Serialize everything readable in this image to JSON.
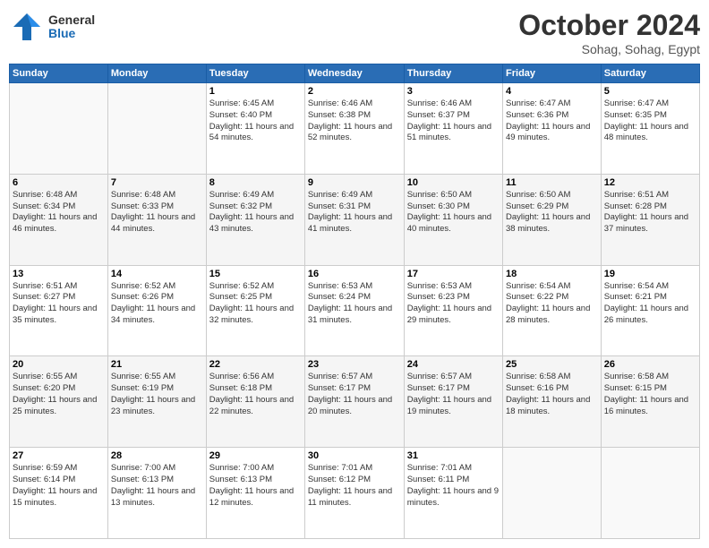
{
  "header": {
    "logo_general": "General",
    "logo_blue": "Blue",
    "month": "October 2024",
    "location": "Sohag, Sohag, Egypt"
  },
  "weekdays": [
    "Sunday",
    "Monday",
    "Tuesday",
    "Wednesday",
    "Thursday",
    "Friday",
    "Saturday"
  ],
  "weeks": [
    [
      {
        "day": "",
        "info": ""
      },
      {
        "day": "",
        "info": ""
      },
      {
        "day": "1",
        "info": "Sunrise: 6:45 AM\nSunset: 6:40 PM\nDaylight: 11 hours and 54 minutes."
      },
      {
        "day": "2",
        "info": "Sunrise: 6:46 AM\nSunset: 6:38 PM\nDaylight: 11 hours and 52 minutes."
      },
      {
        "day": "3",
        "info": "Sunrise: 6:46 AM\nSunset: 6:37 PM\nDaylight: 11 hours and 51 minutes."
      },
      {
        "day": "4",
        "info": "Sunrise: 6:47 AM\nSunset: 6:36 PM\nDaylight: 11 hours and 49 minutes."
      },
      {
        "day": "5",
        "info": "Sunrise: 6:47 AM\nSunset: 6:35 PM\nDaylight: 11 hours and 48 minutes."
      }
    ],
    [
      {
        "day": "6",
        "info": "Sunrise: 6:48 AM\nSunset: 6:34 PM\nDaylight: 11 hours and 46 minutes."
      },
      {
        "day": "7",
        "info": "Sunrise: 6:48 AM\nSunset: 6:33 PM\nDaylight: 11 hours and 44 minutes."
      },
      {
        "day": "8",
        "info": "Sunrise: 6:49 AM\nSunset: 6:32 PM\nDaylight: 11 hours and 43 minutes."
      },
      {
        "day": "9",
        "info": "Sunrise: 6:49 AM\nSunset: 6:31 PM\nDaylight: 11 hours and 41 minutes."
      },
      {
        "day": "10",
        "info": "Sunrise: 6:50 AM\nSunset: 6:30 PM\nDaylight: 11 hours and 40 minutes."
      },
      {
        "day": "11",
        "info": "Sunrise: 6:50 AM\nSunset: 6:29 PM\nDaylight: 11 hours and 38 minutes."
      },
      {
        "day": "12",
        "info": "Sunrise: 6:51 AM\nSunset: 6:28 PM\nDaylight: 11 hours and 37 minutes."
      }
    ],
    [
      {
        "day": "13",
        "info": "Sunrise: 6:51 AM\nSunset: 6:27 PM\nDaylight: 11 hours and 35 minutes."
      },
      {
        "day": "14",
        "info": "Sunrise: 6:52 AM\nSunset: 6:26 PM\nDaylight: 11 hours and 34 minutes."
      },
      {
        "day": "15",
        "info": "Sunrise: 6:52 AM\nSunset: 6:25 PM\nDaylight: 11 hours and 32 minutes."
      },
      {
        "day": "16",
        "info": "Sunrise: 6:53 AM\nSunset: 6:24 PM\nDaylight: 11 hours and 31 minutes."
      },
      {
        "day": "17",
        "info": "Sunrise: 6:53 AM\nSunset: 6:23 PM\nDaylight: 11 hours and 29 minutes."
      },
      {
        "day": "18",
        "info": "Sunrise: 6:54 AM\nSunset: 6:22 PM\nDaylight: 11 hours and 28 minutes."
      },
      {
        "day": "19",
        "info": "Sunrise: 6:54 AM\nSunset: 6:21 PM\nDaylight: 11 hours and 26 minutes."
      }
    ],
    [
      {
        "day": "20",
        "info": "Sunrise: 6:55 AM\nSunset: 6:20 PM\nDaylight: 11 hours and 25 minutes."
      },
      {
        "day": "21",
        "info": "Sunrise: 6:55 AM\nSunset: 6:19 PM\nDaylight: 11 hours and 23 minutes."
      },
      {
        "day": "22",
        "info": "Sunrise: 6:56 AM\nSunset: 6:18 PM\nDaylight: 11 hours and 22 minutes."
      },
      {
        "day": "23",
        "info": "Sunrise: 6:57 AM\nSunset: 6:17 PM\nDaylight: 11 hours and 20 minutes."
      },
      {
        "day": "24",
        "info": "Sunrise: 6:57 AM\nSunset: 6:17 PM\nDaylight: 11 hours and 19 minutes."
      },
      {
        "day": "25",
        "info": "Sunrise: 6:58 AM\nSunset: 6:16 PM\nDaylight: 11 hours and 18 minutes."
      },
      {
        "day": "26",
        "info": "Sunrise: 6:58 AM\nSunset: 6:15 PM\nDaylight: 11 hours and 16 minutes."
      }
    ],
    [
      {
        "day": "27",
        "info": "Sunrise: 6:59 AM\nSunset: 6:14 PM\nDaylight: 11 hours and 15 minutes."
      },
      {
        "day": "28",
        "info": "Sunrise: 7:00 AM\nSunset: 6:13 PM\nDaylight: 11 hours and 13 minutes."
      },
      {
        "day": "29",
        "info": "Sunrise: 7:00 AM\nSunset: 6:13 PM\nDaylight: 11 hours and 12 minutes."
      },
      {
        "day": "30",
        "info": "Sunrise: 7:01 AM\nSunset: 6:12 PM\nDaylight: 11 hours and 11 minutes."
      },
      {
        "day": "31",
        "info": "Sunrise: 7:01 AM\nSunset: 6:11 PM\nDaylight: 11 hours and 9 minutes."
      },
      {
        "day": "",
        "info": ""
      },
      {
        "day": "",
        "info": ""
      }
    ]
  ]
}
